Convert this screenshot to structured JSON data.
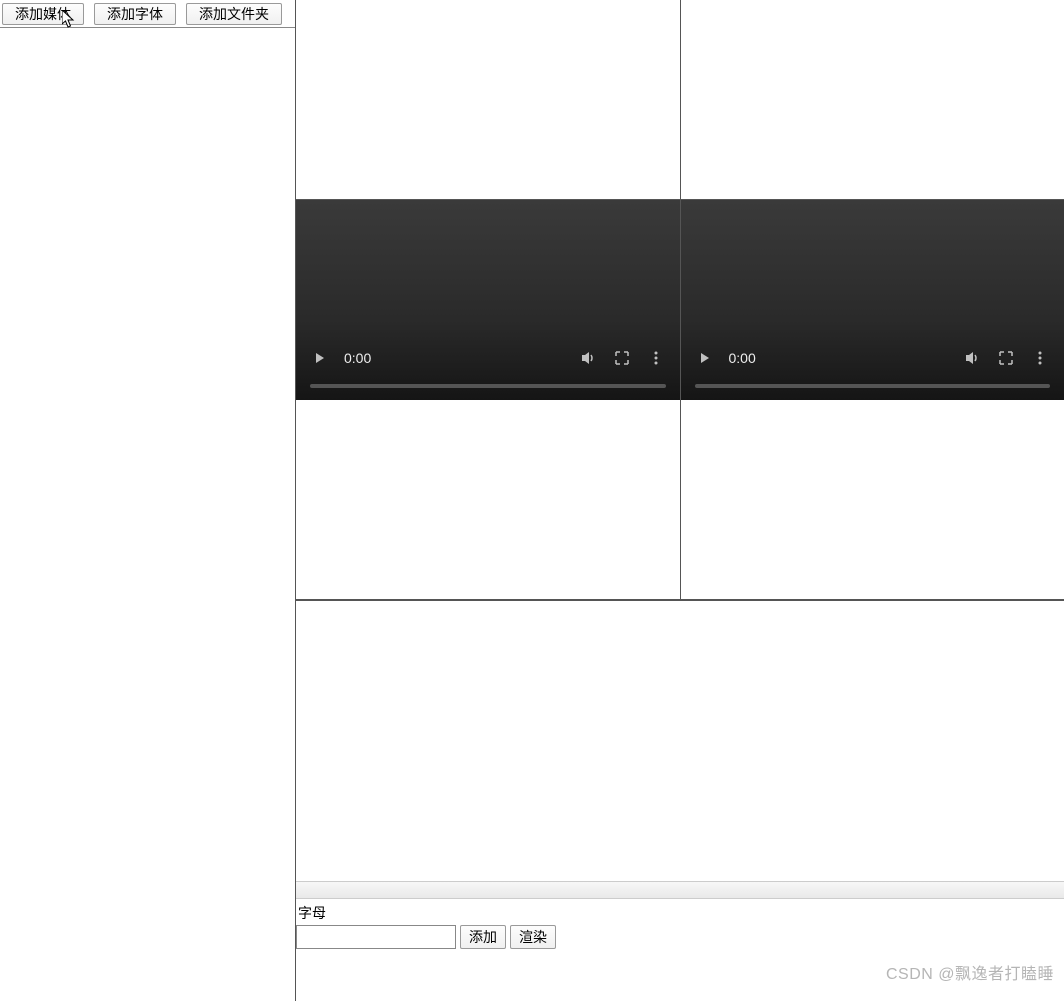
{
  "toolbar": {
    "add_media": "添加媒体",
    "add_font": "添加字体",
    "add_folder": "添加文件夹"
  },
  "video": {
    "time_left": "0:00",
    "time_right": "0:00",
    "icons": {
      "play": "play-icon",
      "volume": "volume-icon",
      "fullscreen": "fullscreen-icon",
      "menu": "more-icon"
    }
  },
  "form": {
    "label": "字母",
    "input_value": "",
    "add": "添加",
    "render": "渲染"
  },
  "watermark": "CSDN @飘逸者打瞌睡"
}
